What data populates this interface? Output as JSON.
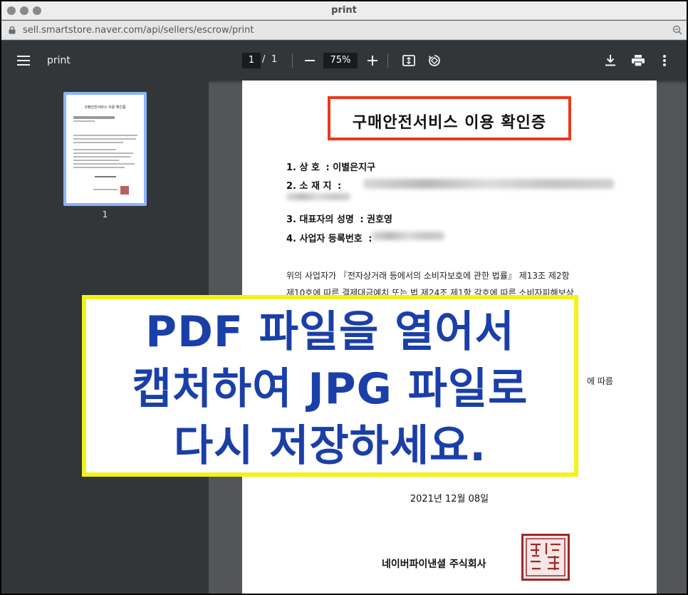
{
  "window": {
    "title": "print",
    "url": "sell.smartstore.naver.com/api/sellers/escrow/print"
  },
  "toolbar": {
    "doc_title": "print",
    "current_page": "1",
    "page_separator": "/",
    "total_pages": "1",
    "zoom": "75%",
    "icons": [
      "menu-icon",
      "zoom-out-icon",
      "zoom-in-icon",
      "fit-page-icon",
      "rotate-icon",
      "download-icon",
      "print-icon",
      "more-icon"
    ]
  },
  "sidebar": {
    "thumbnail_label": "1",
    "thumbnail_title": "구매안전서비스 이용 확인증"
  },
  "document": {
    "heading": "구매안전서비스 이용 확인증",
    "fields": [
      {
        "label": "1. 상          호",
        "value": ": 이별은지구"
      },
      {
        "label": "2. 소    재    지",
        "value": ":"
      },
      {
        "label": "3. 대표자의 성명",
        "value": ": 권호영"
      },
      {
        "label": "4. 사업자 등록번호",
        "value": ":"
      }
    ],
    "paragraph_lines": [
      "위의 사업자가 『전자상거래 등에서의 소비자보호에 관한 법률』 제13조 제2항",
      "제10호에 따른 결제대금예치 또는 법 제24조 제1항 각호에 따른 소비자피해보상"
    ],
    "partial_text": "에 따름",
    "date": "2021년 12월 08일",
    "company": "네이버파이낸셜 주식회사"
  },
  "overlay": {
    "lines": [
      "PDF 파일을 열어서",
      "캡처하여 JPG 파일로",
      "다시 저장하세요."
    ],
    "text_color": "#1a3fa8",
    "border_color": "#f2f21a"
  },
  "colors": {
    "toolbar_bg": "#323639",
    "viewer_bg": "#525659",
    "heading_border": "#e8391d",
    "seal": "#9c2a2a"
  }
}
